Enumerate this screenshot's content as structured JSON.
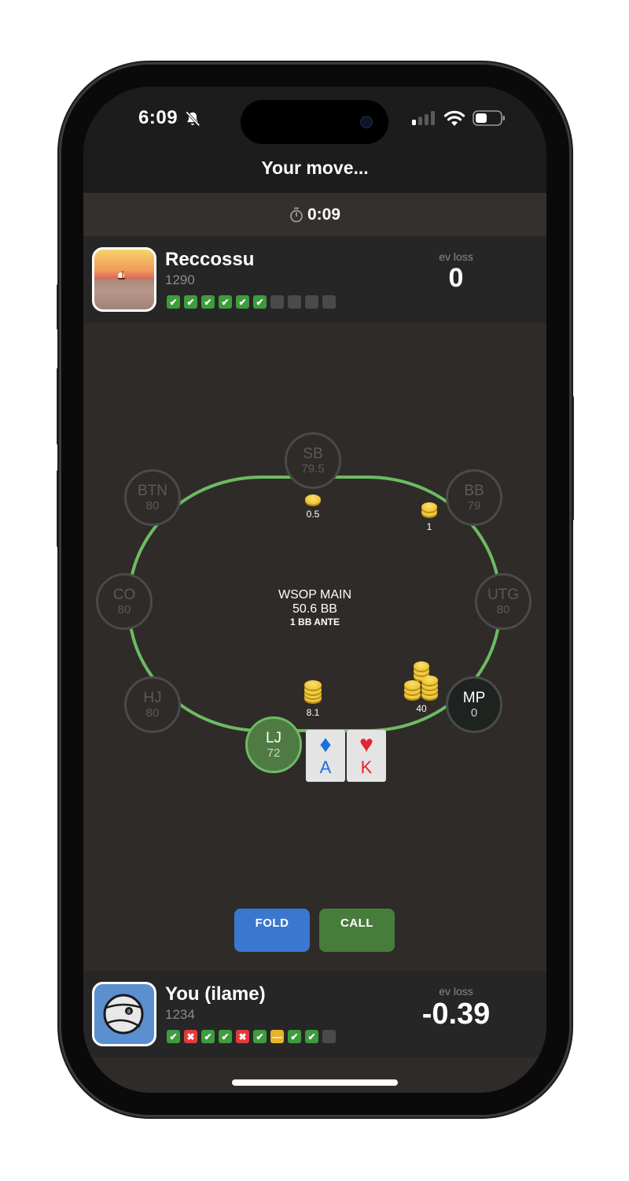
{
  "status_bar": {
    "time": "6:09",
    "icons": [
      "bell-slash-icon",
      "cellular-signal-icon",
      "wifi-icon",
      "battery-icon"
    ]
  },
  "header": {
    "title": "Your move..."
  },
  "timer": {
    "icon": "stopwatch-icon",
    "value": "0:09"
  },
  "opponent": {
    "name": "Reccossu",
    "rating": "1290",
    "ev_label": "ev loss",
    "ev_value": "0",
    "results": [
      "win",
      "win",
      "win",
      "win",
      "win",
      "win",
      "empty",
      "empty",
      "empty",
      "empty"
    ]
  },
  "table": {
    "title": "WSOP MAIN",
    "pot": "50.6 BB",
    "ante": "1 BB ANTE",
    "seats": [
      {
        "position": "SB",
        "stack": "79.5"
      },
      {
        "position": "BTN",
        "stack": "80"
      },
      {
        "position": "BB",
        "stack": "79"
      },
      {
        "position": "CO",
        "stack": "80"
      },
      {
        "position": "UTG",
        "stack": "80"
      },
      {
        "position": "HJ",
        "stack": "80"
      },
      {
        "position": "MP",
        "stack": "0"
      },
      {
        "position": "LJ",
        "stack": "72"
      }
    ],
    "bets": {
      "sb": "0.5",
      "bb": "1",
      "lj": "8.1",
      "mp": "40"
    },
    "hero_cards": [
      {
        "rank": "A",
        "suit": "♦",
        "suit_name": "diamonds",
        "color": "#1a6fe0"
      },
      {
        "rank": "K",
        "suit": "♥",
        "suit_name": "hearts",
        "color": "#e3242b"
      }
    ]
  },
  "actions": {
    "fold_label": "FOLD",
    "call_label": "CALL"
  },
  "hero": {
    "name": "You (ilame)",
    "rating": "1234",
    "ev_label": "ev loss",
    "ev_value": "-0.39",
    "results": [
      "win",
      "loss",
      "win",
      "win",
      "loss",
      "win",
      "draw",
      "win",
      "win",
      "empty"
    ]
  },
  "colors": {
    "felt_rail": "#6dbb62",
    "fold_button": "#3a78d0",
    "call_button": "#477d3b",
    "win": "#3e9b3e",
    "loss": "#e23b3b",
    "draw": "#e6b42a"
  }
}
